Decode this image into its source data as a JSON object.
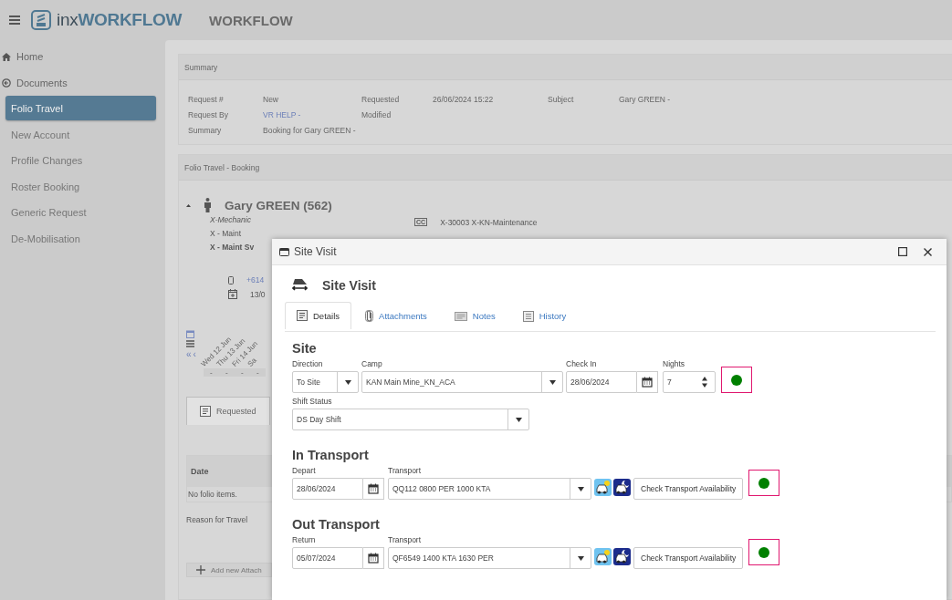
{
  "header": {
    "logo": {
      "prefix": "inx",
      "name": "WORKFLOW"
    },
    "title": "WORKFLOW"
  },
  "sidebar": {
    "items": [
      {
        "label": "Home",
        "kind": "home",
        "selected": false
      },
      {
        "label": "Documents",
        "kind": "group",
        "selected": false
      },
      {
        "label": "Folio Travel",
        "kind": "item",
        "selected": true
      },
      {
        "label": "New Account",
        "kind": "item",
        "selected": false
      },
      {
        "label": "Profile Changes",
        "kind": "item",
        "selected": false
      },
      {
        "label": "Roster Booking",
        "kind": "item",
        "selected": false
      },
      {
        "label": "Generic Request",
        "kind": "item",
        "selected": false
      },
      {
        "label": "De-Mobilisation",
        "kind": "item",
        "selected": false
      }
    ]
  },
  "summary": {
    "title": "Summary",
    "rows": [
      [
        {
          "label": "Request #",
          "value": "New",
          "link": false
        },
        {
          "label": "Requested",
          "value": "26/06/2024 15:22",
          "link": false
        },
        {
          "label": "Subject",
          "value": "Gary GREEN -",
          "link": false
        }
      ],
      [
        {
          "label": "Request By",
          "value": "VR HELP -",
          "link": true
        },
        {
          "label": "Modified"
        }
      ],
      [
        {
          "label": "Summary",
          "value": "Booking for Gary GREEN -",
          "link": false
        }
      ]
    ]
  },
  "booking": {
    "title": "Folio Travel - Booking",
    "person": {
      "name": "Gary GREEN (562)",
      "role": "X-Mechanic",
      "unit": "X - Maint",
      "team": "X - Maint Sv",
      "cc_badge": "CC",
      "cost_centre": "X-30003 X-KN-Maintenance",
      "phone": "+614",
      "date": "13/0"
    },
    "nav": [
      "«",
      "‹"
    ],
    "days": [
      "Wed 12 Jun",
      "Thu 13 Jun",
      "Fri 14 Jun",
      "Sa"
    ],
    "day_marks": [
      "-",
      "-",
      "-",
      "-"
    ],
    "tabs": [
      {
        "label": "Requested",
        "selected": true
      }
    ],
    "table": {
      "columns": [
        "Date"
      ],
      "empty": "No folio items."
    },
    "reason_label": "Reason for Travel",
    "add_button": "Add new Attach"
  },
  "dialog": {
    "title": "Site Visit",
    "heading": "Site Visit",
    "tabs": [
      {
        "label": "Details",
        "kind": "details",
        "selected": true
      },
      {
        "label": "Attachments",
        "kind": "attachments",
        "selected": false
      },
      {
        "label": "Notes",
        "kind": "notes",
        "selected": false
      },
      {
        "label": "History",
        "kind": "history",
        "selected": false
      }
    ],
    "site": {
      "heading": "Site",
      "direction": {
        "label": "Direction",
        "value": "To Site"
      },
      "camp": {
        "label": "Camp",
        "value": "KAN Main Mine_KN_ACA"
      },
      "check_in": {
        "label": "Check In",
        "value": "28/06/2024"
      },
      "nights": {
        "label": "Nights",
        "value": "7"
      },
      "status": {
        "color": "#008000"
      },
      "shift_status": {
        "label": "Shift Status",
        "value": "DS Day Shift"
      }
    },
    "transports": [
      {
        "heading": "In Transport",
        "date": {
          "label": "Depart",
          "value": "28/06/2024"
        },
        "transport": {
          "label": "Transport",
          "value": "QQ112 0800 PER 1000 KTA"
        },
        "button": "Check Transport Availability",
        "status": {
          "color": "#008000"
        }
      },
      {
        "heading": "Out Transport",
        "date": {
          "label": "Return",
          "value": "05/07/2024"
        },
        "transport": {
          "label": "Transport",
          "value": "QF6549 1400 KTA 1630 PER"
        },
        "button": "Check Transport Availability",
        "status": {
          "color": "#008000"
        }
      }
    ]
  }
}
